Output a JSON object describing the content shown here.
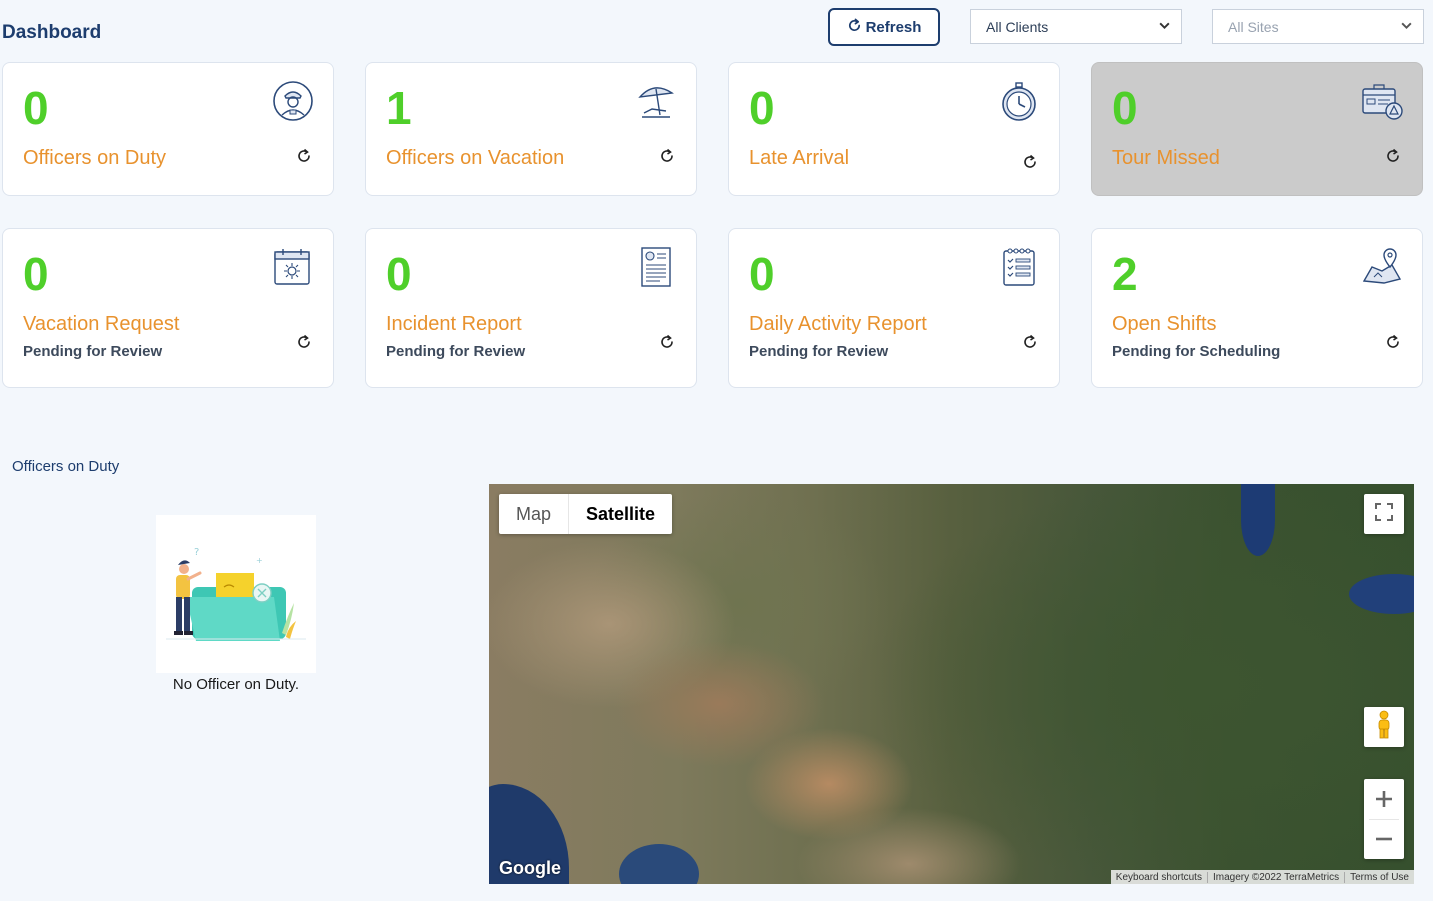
{
  "header": {
    "title": "Dashboard",
    "refresh_label": "Refresh",
    "clients_select": "All Clients",
    "sites_select": "All Sites"
  },
  "cards": [
    {
      "count": "0",
      "title": "Officers on Duty",
      "subtitle": "",
      "icon": "officer-icon"
    },
    {
      "count": "1",
      "title": "Officers on Vacation",
      "subtitle": "",
      "icon": "beach-umbrella-icon"
    },
    {
      "count": "0",
      "title": "Late Arrival",
      "subtitle": "",
      "icon": "stopwatch-icon"
    },
    {
      "count": "0",
      "title": "Tour Missed",
      "subtitle": "",
      "icon": "tour-alert-icon"
    },
    {
      "count": "0",
      "title": "Vacation Request",
      "subtitle": "Pending for Review",
      "icon": "calendar-sun-icon"
    },
    {
      "count": "0",
      "title": "Incident Report",
      "subtitle": "Pending for Review",
      "icon": "report-document-icon"
    },
    {
      "count": "0",
      "title": "Daily Activity Report",
      "subtitle": "Pending for Review",
      "icon": "checklist-icon"
    },
    {
      "count": "2",
      "title": "Open Shifts",
      "subtitle": "Pending for Scheduling",
      "icon": "map-pin-icon"
    }
  ],
  "officers_section": {
    "title": "Officers on Duty",
    "empty_text": "No Officer on Duty."
  },
  "map": {
    "map_tab": "Map",
    "satellite_tab": "Satellite",
    "logo": "Google",
    "attribution": [
      "Keyboard shortcuts",
      "Imagery ©2022 TerraMetrics",
      "Terms of Use"
    ]
  },
  "colors": {
    "count": "#4fcf2a",
    "title": "#e8922e",
    "primary": "#1d3d6e"
  }
}
